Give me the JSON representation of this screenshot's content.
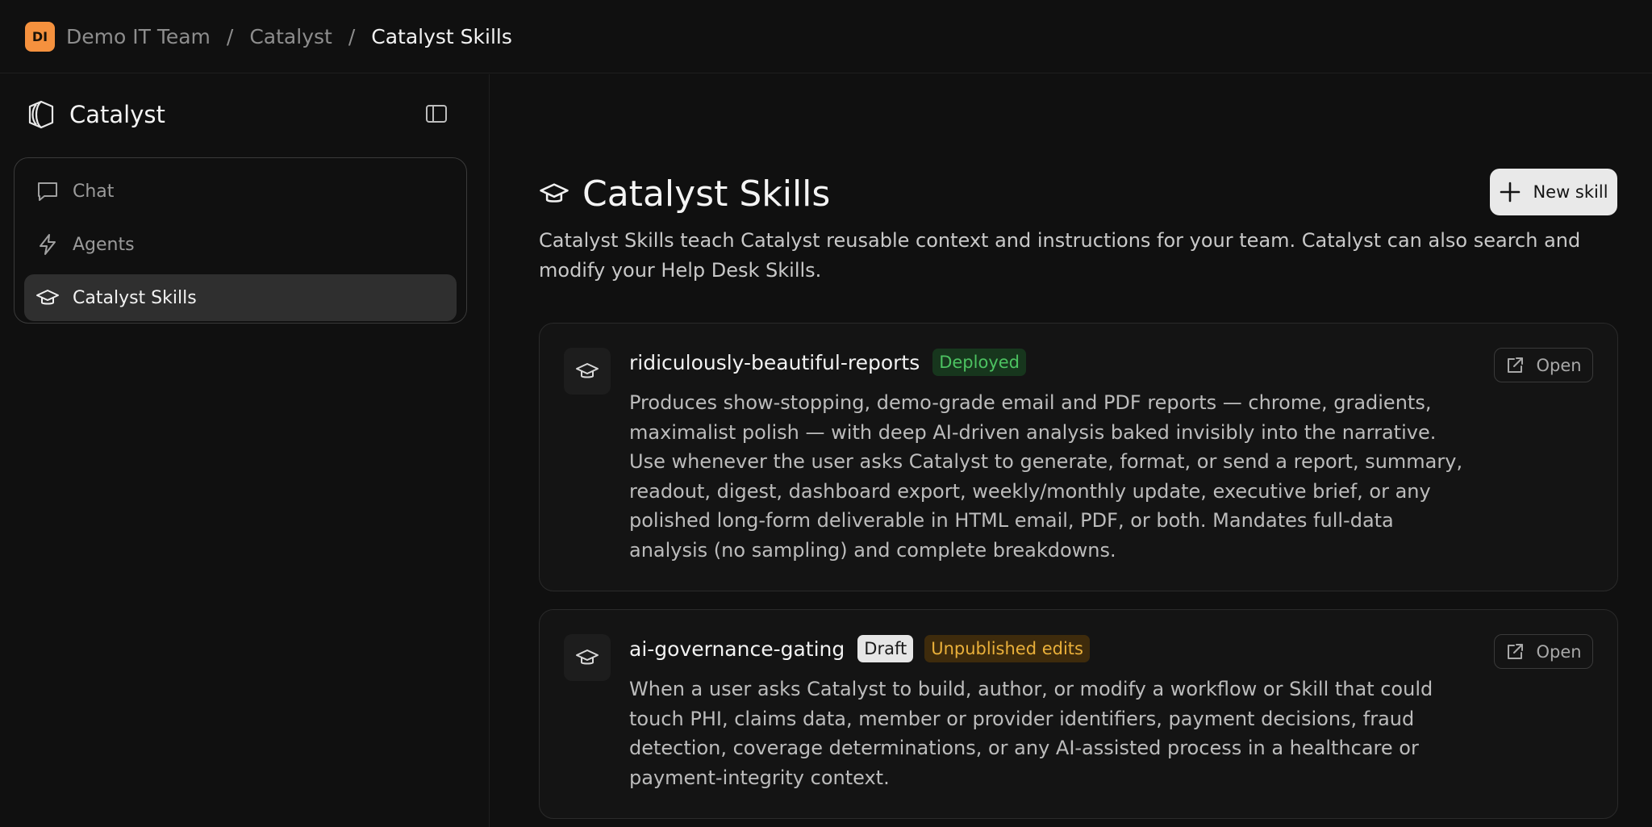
{
  "breadcrumb": {
    "org_initials": "DI",
    "items": [
      "Demo IT Team",
      "Catalyst",
      "Catalyst Skills"
    ],
    "separator": "/"
  },
  "sidebar": {
    "brand": "Catalyst",
    "nav": [
      {
        "label": "Chat",
        "icon": "chat-bubble-icon",
        "active": false
      },
      {
        "label": "Agents",
        "icon": "lightning-icon",
        "active": false
      },
      {
        "label": "Catalyst Skills",
        "icon": "graduation-cap-icon",
        "active": true
      }
    ]
  },
  "main": {
    "title": "Catalyst Skills",
    "new_button_label": "New skill",
    "description": "Catalyst Skills teach Catalyst reusable context and instructions for your team. Catalyst can also search and modify your Help Desk Skills.",
    "skills": [
      {
        "name": "ridiculously-beautiful-reports",
        "badges": [
          "Deployed"
        ],
        "description": "Produces show-stopping, demo-grade email and PDF reports — chrome, gradients, maximalist polish — with deep AI-driven analysis baked invisibly into the narrative. Use whenever the user asks Catalyst to generate, format, or send a report, summary, readout, digest, dashboard export, weekly/monthly update, executive brief, or any polished long-form deliverable in HTML email, PDF, or both. Mandates full-data analysis (no sampling) and complete breakdowns.",
        "open_label": "Open"
      },
      {
        "name": "ai-governance-gating",
        "badges": [
          "Draft",
          "Unpublished edits"
        ],
        "description": "When a user asks Catalyst to build, author, or modify a workflow or Skill that could touch PHI, claims data, member or provider identifiers, payment decisions, fraud detection, coverage determinations, or any AI-assisted process in a healthcare or payment-integrity context.",
        "open_label": "Open"
      }
    ]
  },
  "colors": {
    "background": "#101010",
    "org_badge": "#f5913e",
    "deployed_badge_bg": "#17361d",
    "deployed_badge_text": "#4cc261",
    "unpublished_badge_bg": "#3e2b0c",
    "unpublished_badge_text": "#eab03a",
    "primary_button": "#e9e9e9"
  }
}
